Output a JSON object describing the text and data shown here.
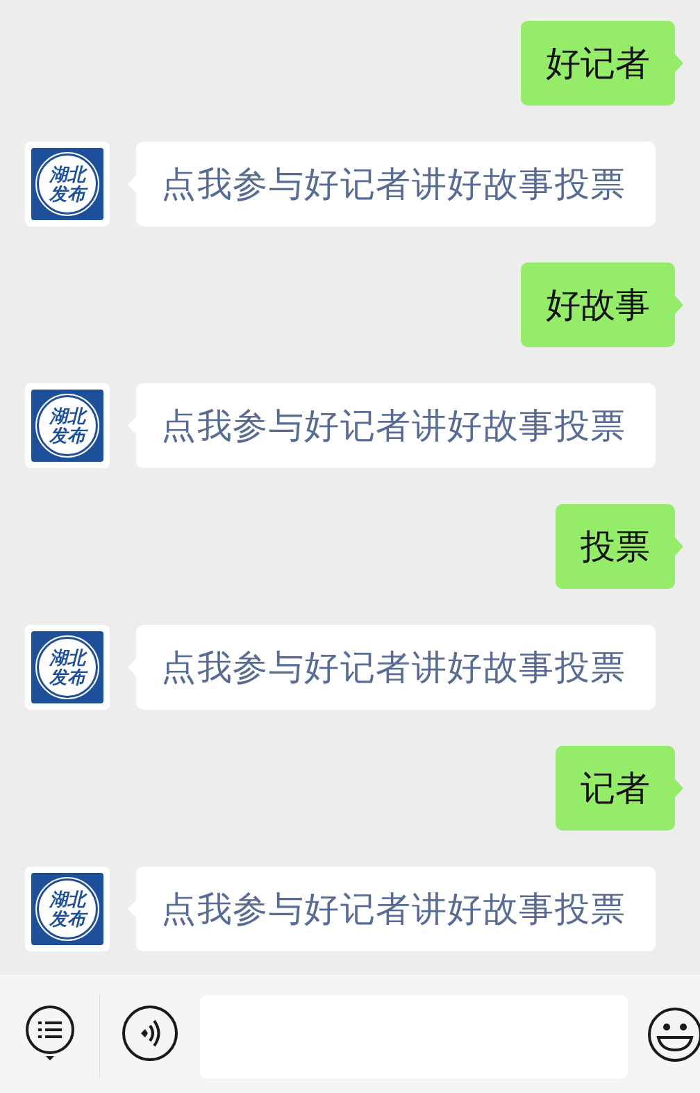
{
  "messages": [
    {
      "kind": "sent",
      "text": "好记者"
    },
    {
      "kind": "received",
      "avatar_text": [
        "湖北",
        "发布"
      ],
      "text": "点我参与好记者讲好故事投票"
    },
    {
      "kind": "sent",
      "text": "好故事"
    },
    {
      "kind": "received",
      "avatar_text": [
        "湖北",
        "发布"
      ],
      "text": "点我参与好记者讲好故事投票"
    },
    {
      "kind": "sent",
      "text": "投票"
    },
    {
      "kind": "received",
      "avatar_text": [
        "湖北",
        "发布"
      ],
      "text": "点我参与好记者讲好故事投票"
    },
    {
      "kind": "sent",
      "text": "记者"
    },
    {
      "kind": "received",
      "avatar_text": [
        "湖北",
        "发布"
      ],
      "text": "点我参与好记者讲好故事投票"
    }
  ]
}
